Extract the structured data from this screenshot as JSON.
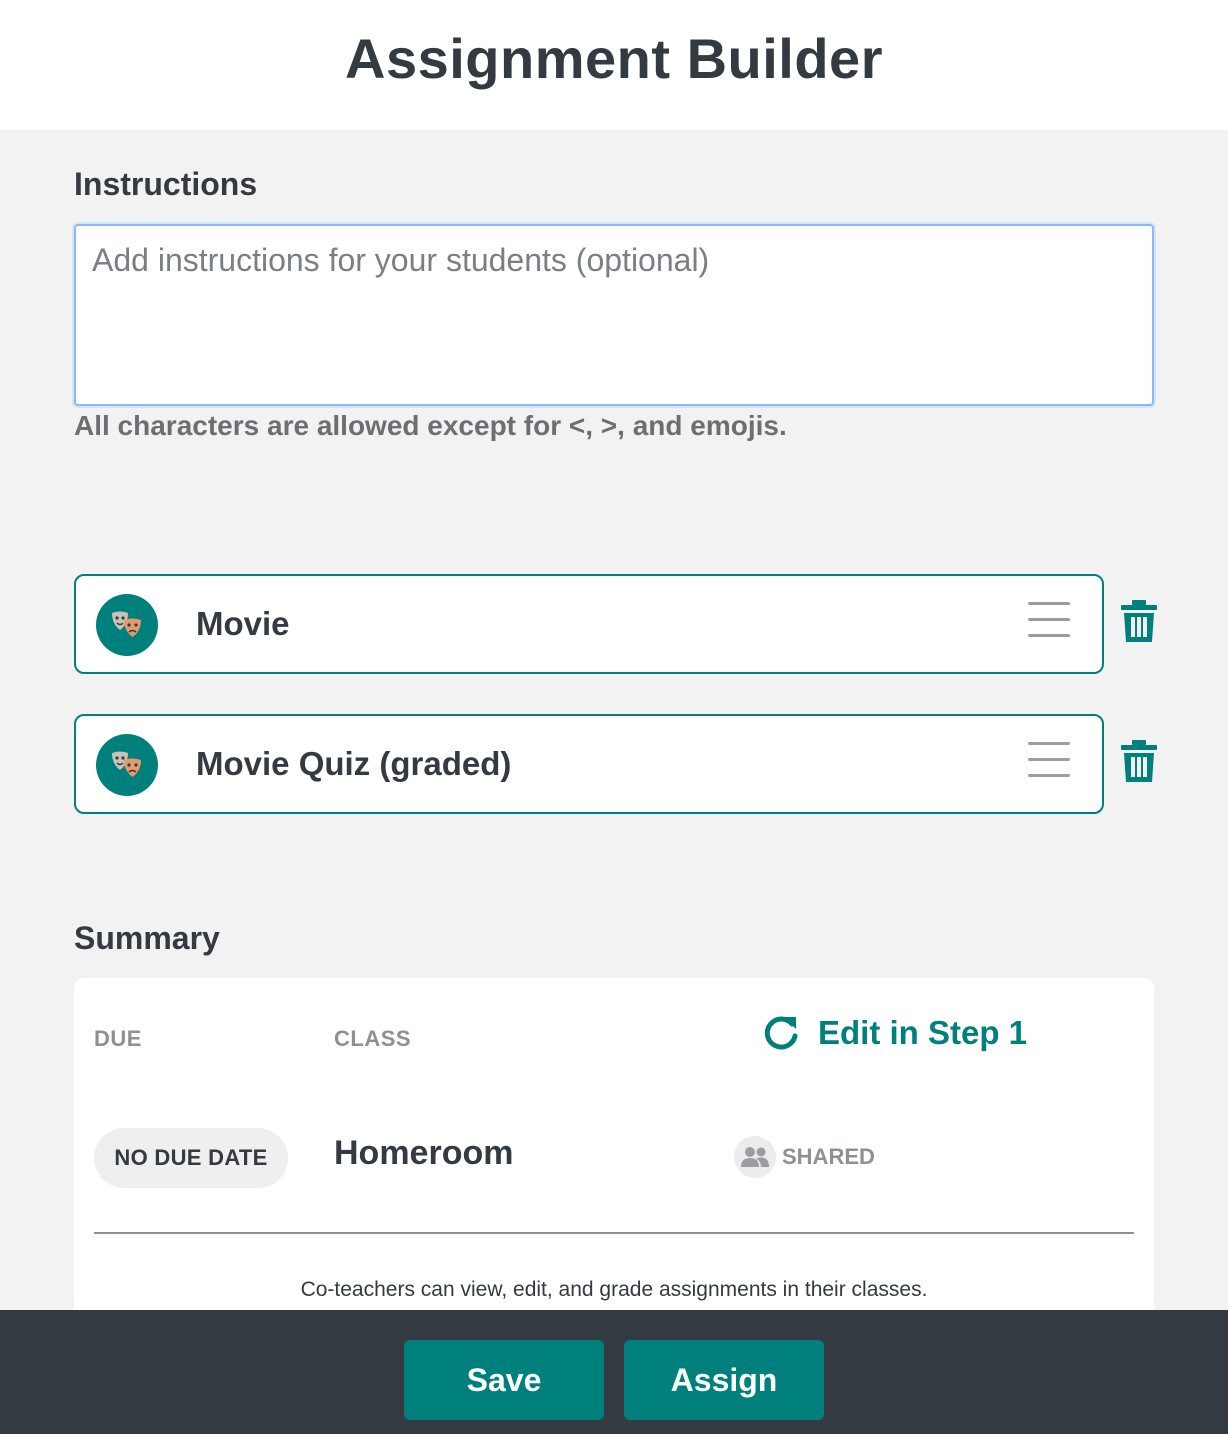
{
  "header": {
    "title": "Assignment Builder"
  },
  "instructions": {
    "label": "Instructions",
    "placeholder": "Add instructions for your students (optional)",
    "value": "",
    "hint": "All characters are allowed except for <, >, and emojis."
  },
  "activities": [
    {
      "name": "Movie",
      "icon": "movie-masks-icon"
    },
    {
      "name": "Movie Quiz (graded)",
      "icon": "movie-masks-icon"
    }
  ],
  "summary": {
    "label": "Summary",
    "due_header": "DUE",
    "class_header": "CLASS",
    "edit_label": "Edit in Step 1",
    "due_value": "NO DUE DATE",
    "class_value": "Homeroom",
    "shared_label": "SHARED",
    "coteacher_note": "Co-teachers can view, edit, and grade assignments in their classes."
  },
  "footer": {
    "save_label": "Save",
    "assign_label": "Assign"
  },
  "colors": {
    "accent": "#00807c",
    "text": "#343a41",
    "footer_bg": "#343a41",
    "page_bg": "#f2f2f2"
  }
}
